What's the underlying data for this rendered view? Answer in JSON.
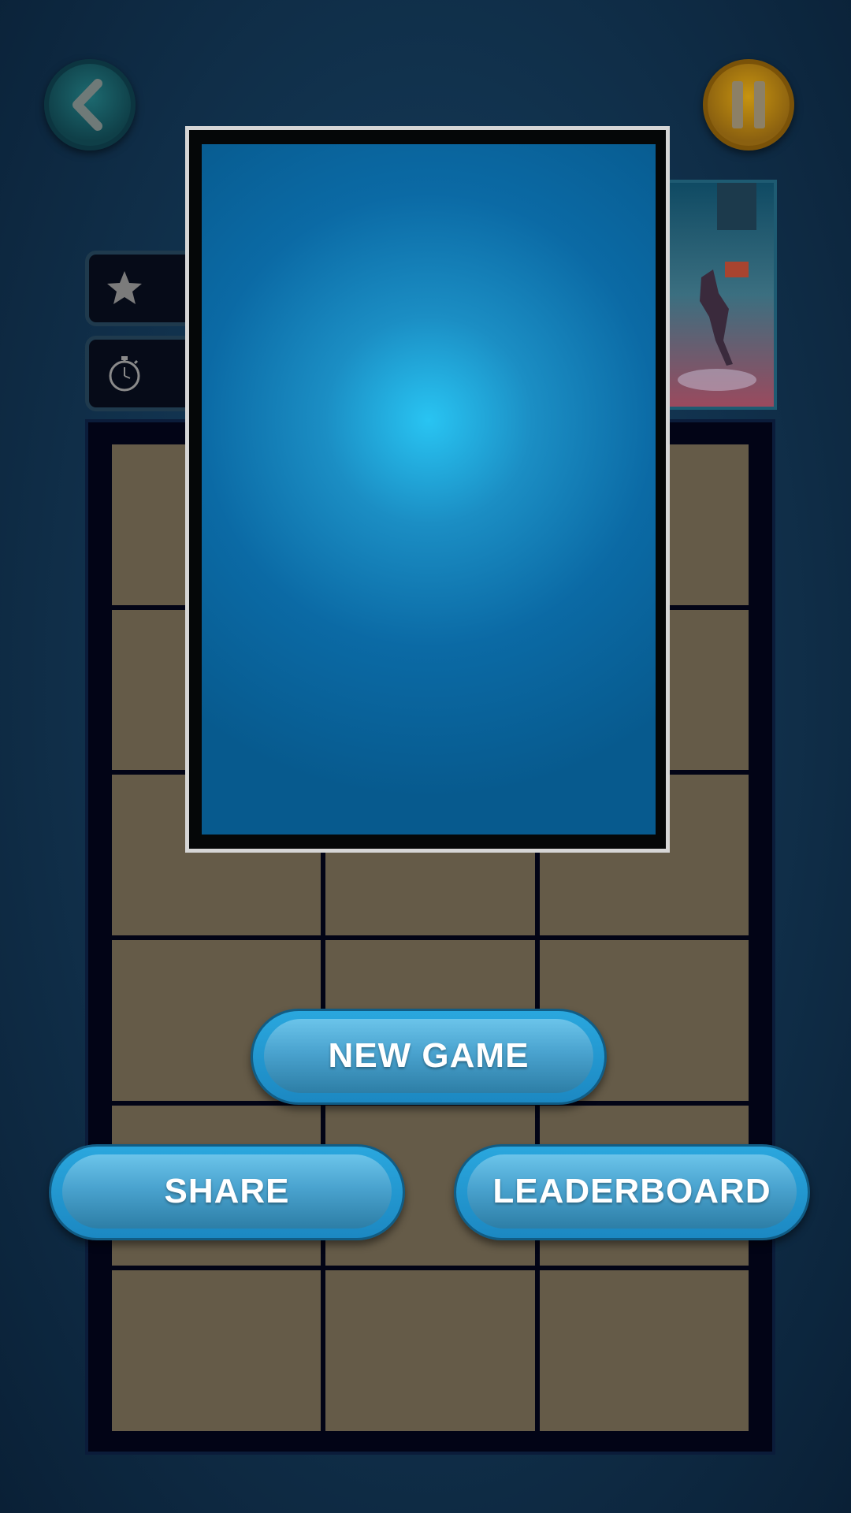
{
  "buttons": {
    "new_game": "NEW GAME",
    "share": "SHARE",
    "leaderboard": "LEADERBOARD"
  },
  "icons": {
    "back": "chevron-left-icon",
    "pause": "pause-icon",
    "score": "star-icon",
    "timer": "stopwatch-icon"
  },
  "board": {
    "rows": 6,
    "columns": 3
  },
  "colors": {
    "board_tile": "#655b48",
    "card_blue": "#0b6aa5",
    "button_blue": "#2aa7de",
    "pause_gold": "#c79410",
    "back_teal": "#1d6a70"
  }
}
